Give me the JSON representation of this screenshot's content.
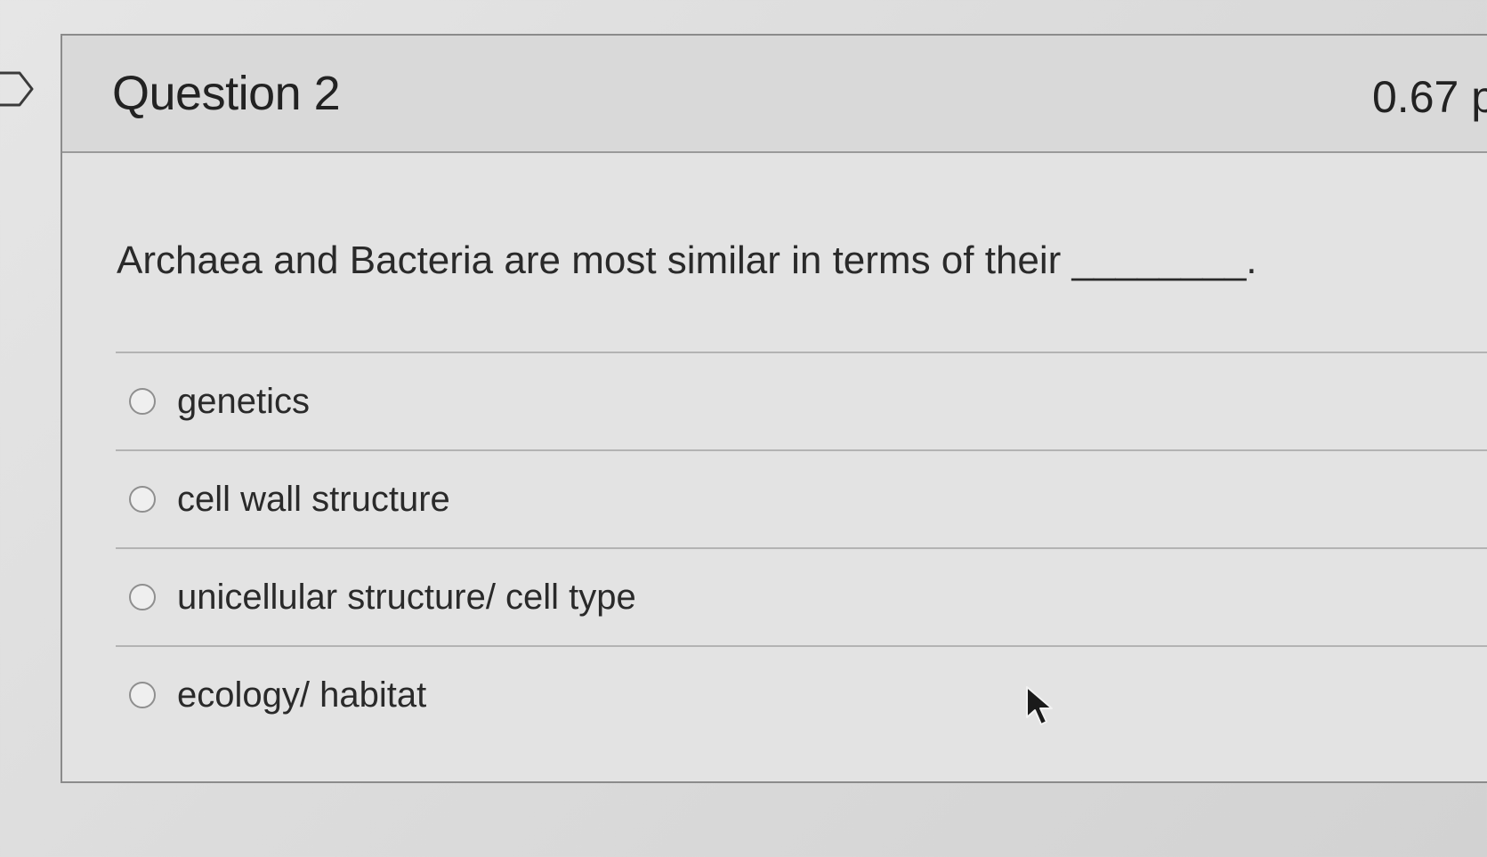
{
  "question": {
    "title": "Question 2",
    "points": "0.67 p",
    "text": "Archaea and Bacteria are most similar in terms of their ________.",
    "answers": [
      {
        "label": "genetics",
        "selected": false
      },
      {
        "label": "cell wall structure",
        "selected": false
      },
      {
        "label": "unicellular structure/ cell type",
        "selected": false
      },
      {
        "label": "ecology/ habitat",
        "selected": false
      }
    ]
  },
  "icons": {
    "flag": "bookmark-flag-icon",
    "cursor": "mouse-pointer-icon",
    "radio": "radio-button-icon"
  },
  "colors": {
    "border": "#8b8b8b",
    "header_bg": "#d9d9d9",
    "text": "#2a2a2a"
  }
}
